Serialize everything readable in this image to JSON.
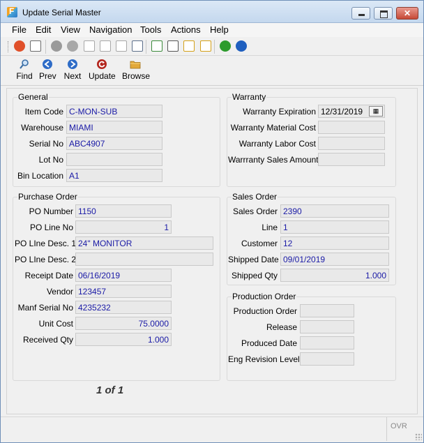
{
  "window": {
    "title": "Update Serial Master"
  },
  "menu": [
    "File",
    "Edit",
    "View",
    "Navigation",
    "Tools",
    "Actions",
    "Help"
  ],
  "toolbar_icons": [
    {
      "name": "close-form-icon",
      "color": "#e0502a"
    },
    {
      "name": "print-icon",
      "color": "#6b6b6b"
    },
    {
      "name": "check-icon",
      "color": "#9a9a9a"
    },
    {
      "name": "delete-icon",
      "color": "#a8a8a8"
    },
    {
      "name": "copy-icon",
      "color": "#a8a8a8"
    },
    {
      "name": "paste-icon",
      "color": "#a8a8a8"
    },
    {
      "name": "select-all-icon",
      "color": "#a8a8a8"
    },
    {
      "name": "search-icon",
      "color": "#5c6f8a"
    },
    {
      "name": "notes-icon",
      "color": "#3a8a3a"
    },
    {
      "name": "attachment-icon",
      "color": "#555555"
    },
    {
      "name": "documents-icon",
      "color": "#d4a017"
    },
    {
      "name": "checklist-icon",
      "color": "#d4a017"
    },
    {
      "name": "chart-icon",
      "color": "#2d9b2d"
    },
    {
      "name": "help-icon",
      "color": "#1f5fbf"
    }
  ],
  "actions": {
    "find": "Find",
    "prev": "Prev",
    "next": "Next",
    "update": "Update",
    "browse": "Browse"
  },
  "general": {
    "title": "General",
    "item_code_label": "Item Code",
    "item_code": "C-MON-SUB",
    "warehouse_label": "Warehouse",
    "warehouse": "MIAMI",
    "serial_no_label": "Serial No",
    "serial_no": "ABC4907",
    "lot_no_label": "Lot No",
    "lot_no": "",
    "bin_location_label": "Bin Location",
    "bin_location": "A1"
  },
  "warranty": {
    "title": "Warranty",
    "expiration_label": "Warranty Expiration",
    "expiration": "12/31/2019",
    "material_cost_label": "Warranty Material Cost",
    "material_cost": "",
    "labor_cost_label": "Warranty Labor Cost",
    "labor_cost": "",
    "sales_amount_label": "Warrranty Sales Amount",
    "sales_amount": ""
  },
  "purchase_order": {
    "title": "Purchase Order",
    "po_number_label": "PO Number",
    "po_number": "1150",
    "po_line_no_label": "PO Line No",
    "po_line_no": "1",
    "po_line_desc1_label": "PO LIne Desc. 1",
    "po_line_desc1": "24\" MONITOR",
    "po_line_desc2_label": "PO LIne Desc. 2",
    "po_line_desc2": "",
    "receipt_date_label": "Receipt Date",
    "receipt_date": "06/16/2019",
    "vendor_label": "Vendor",
    "vendor": "123457",
    "manf_serial_no_label": "Manf Serial No",
    "manf_serial_no": "4235232",
    "unit_cost_label": "Unit Cost",
    "unit_cost": "75.0000",
    "received_qty_label": "Received Qty",
    "received_qty": "1.000"
  },
  "sales_order": {
    "title": "Sales Order",
    "sales_order_label": "Sales Order",
    "sales_order": "2390",
    "line_label": "Line",
    "line": "1",
    "customer_label": "Customer",
    "customer": "12",
    "shipped_date_label": "Shipped Date",
    "shipped_date": "09/01/2019",
    "shipped_qty_label": "Shipped Qty",
    "shipped_qty": "1.000"
  },
  "production_order": {
    "title": "Production Order",
    "production_order_label": "Production Order",
    "production_order": "",
    "release_label": "Release",
    "release": "",
    "produced_date_label": "Produced Date",
    "produced_date": "",
    "eng_revision_level_label": "Eng Revision Level",
    "eng_revision_level": ""
  },
  "pager": "1 of 1",
  "status": {
    "mode": "OVR"
  }
}
